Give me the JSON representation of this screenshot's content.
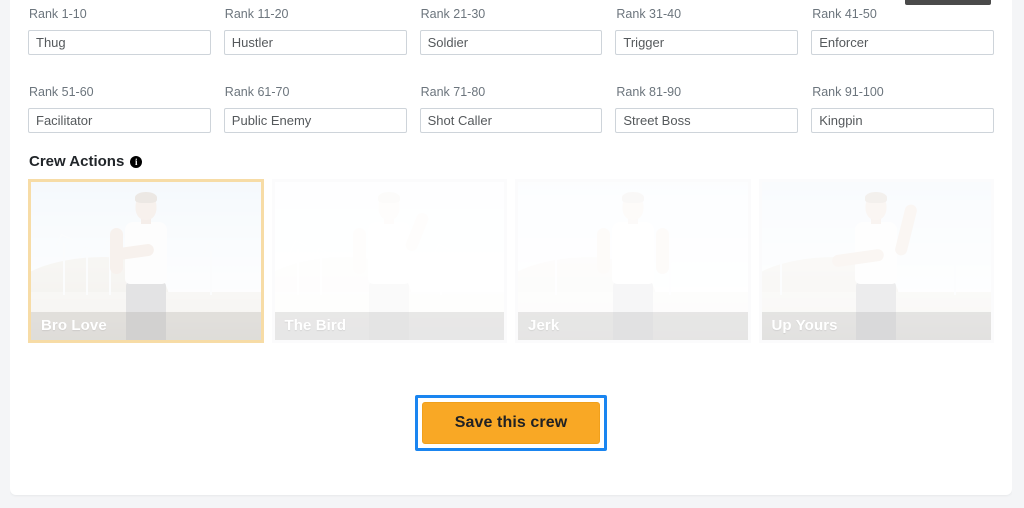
{
  "ranks": {
    "fields": [
      {
        "label": "Rank 1-10",
        "value": "Thug",
        "name": "rank-1-10"
      },
      {
        "label": "Rank 11-20",
        "value": "Hustler",
        "name": "rank-11-20"
      },
      {
        "label": "Rank 21-30",
        "value": "Soldier",
        "name": "rank-21-30"
      },
      {
        "label": "Rank 31-40",
        "value": "Trigger",
        "name": "rank-31-40"
      },
      {
        "label": "Rank 41-50",
        "value": "Enforcer",
        "name": "rank-41-50"
      },
      {
        "label": "Rank 51-60",
        "value": "Facilitator",
        "name": "rank-51-60"
      },
      {
        "label": "Rank 61-70",
        "value": "Public Enemy",
        "name": "rank-61-70"
      },
      {
        "label": "Rank 71-80",
        "value": "Shot Caller",
        "name": "rank-71-80"
      },
      {
        "label": "Rank 81-90",
        "value": "Street Boss",
        "name": "rank-81-90"
      },
      {
        "label": "Rank 91-100",
        "value": "Kingpin",
        "name": "rank-91-100"
      }
    ]
  },
  "crew_actions": {
    "heading": "Crew Actions",
    "info_icon": "info-icon",
    "info_glyph": "i",
    "cards": [
      {
        "label": "Bro Love",
        "selected": true
      },
      {
        "label": "The Bird",
        "selected": false
      },
      {
        "label": "Jerk",
        "selected": false
      },
      {
        "label": "Up Yours",
        "selected": false
      }
    ]
  },
  "save": {
    "label": "Save this crew"
  },
  "colors": {
    "accent_orange": "#f9a825",
    "focus_blue": "#1a85f0",
    "selected_border": "#f7dca6",
    "page_background": "#f4f5f7",
    "panel_background": "#ffffff",
    "label_gray": "#6c757d",
    "input_border": "#ced4da"
  }
}
